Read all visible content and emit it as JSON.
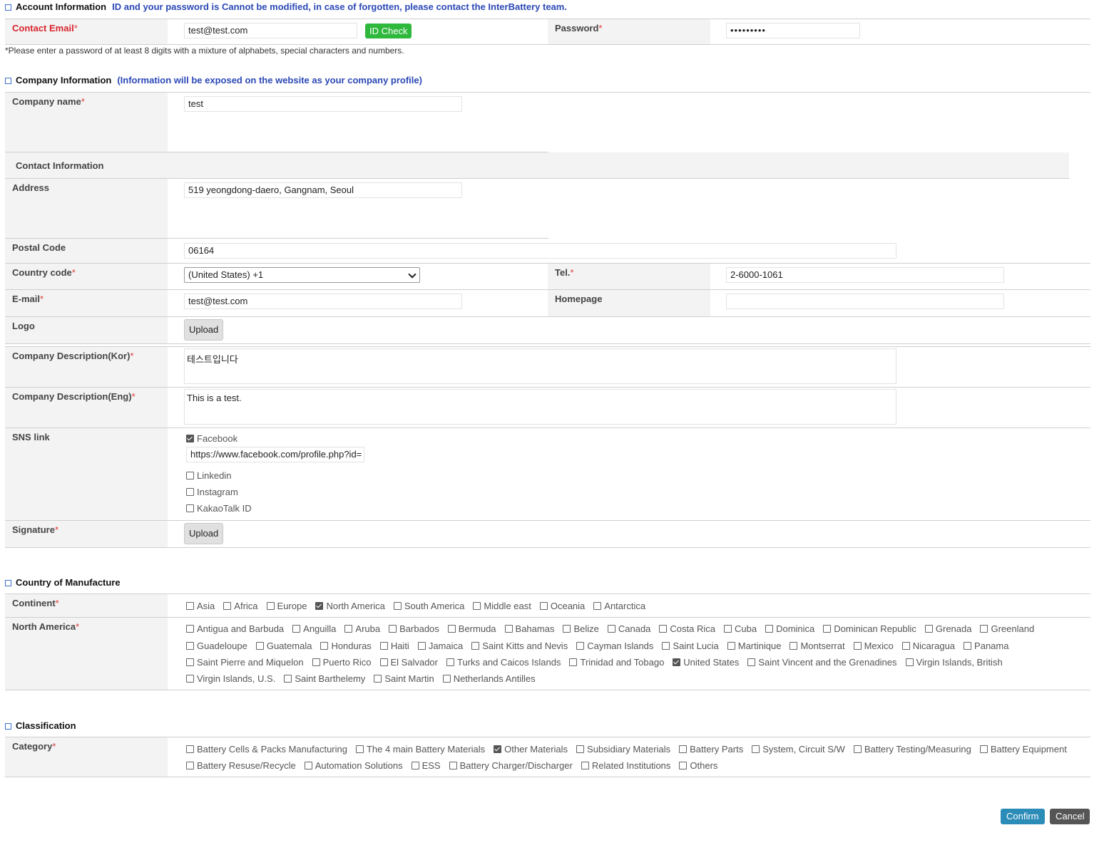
{
  "account": {
    "title": "Account Information",
    "note": "ID and your password is Cannot be modified, in case of forgotten, please contact the InterBattery team.",
    "contact_email_label": "Contact Email",
    "contact_email_value": "test@test.com",
    "id_check": "ID Check",
    "password_label": "Password",
    "password_value": "•••••••••",
    "password_hint": "*Please enter a password of at least 8 digits with a mixture of alphabets, special characters and numbers."
  },
  "company": {
    "title": "Company Information",
    "note": "(Information will be exposed on the website as your company profile)",
    "name_label": "Company name",
    "name_value": "test",
    "contact_info": "Contact Information",
    "address_label": "Address",
    "address_value": "519 yeongdong-daero, Gangnam, Seoul",
    "postal_label": "Postal Code",
    "postal_value": "06164",
    "country_code_label": "Country code",
    "country_code_value": "(United States) +1",
    "tel_label": "Tel.",
    "tel_value": "2-6000-1061",
    "email_label": "E-mail",
    "email_value": "test@test.com",
    "homepage_label": "Homepage",
    "homepage_value": "",
    "logo_label": "Logo",
    "upload": "Upload",
    "desc_kor_label": "Company Description(Kor)",
    "desc_kor_value": "테스트입니다",
    "desc_eng_label": "Company Description(Eng)",
    "desc_eng_value": "This is a test.",
    "sns_label": "SNS link",
    "sns": [
      {
        "label": "Facebook",
        "checked": true
      },
      {
        "label": "Linkedin",
        "checked": false
      },
      {
        "label": "Instagram",
        "checked": false
      },
      {
        "label": "KakaoTalk ID",
        "checked": false
      }
    ],
    "facebook_url": "https://www.facebook.com/profile.php?id=",
    "signature_label": "Signature"
  },
  "manufacture": {
    "title": "Country of Manufacture",
    "continent_label": "Continent",
    "continents": [
      {
        "label": "Asia",
        "checked": false
      },
      {
        "label": "Africa",
        "checked": false
      },
      {
        "label": "Europe",
        "checked": false
      },
      {
        "label": "North America",
        "checked": true
      },
      {
        "label": "South America",
        "checked": false
      },
      {
        "label": "Middle east",
        "checked": false
      },
      {
        "label": "Oceania",
        "checked": false
      },
      {
        "label": "Antarctica",
        "checked": false
      }
    ],
    "region_label": "North America",
    "country_rows": [
      [
        {
          "label": "Antigua and Barbuda",
          "checked": false
        },
        {
          "label": "Anguilla",
          "checked": false
        },
        {
          "label": "Aruba",
          "checked": false
        },
        {
          "label": "Barbados",
          "checked": false
        },
        {
          "label": "Bermuda",
          "checked": false
        },
        {
          "label": "Bahamas",
          "checked": false
        },
        {
          "label": "Belize",
          "checked": false
        },
        {
          "label": "Canada",
          "checked": false
        },
        {
          "label": "Costa Rica",
          "checked": false
        },
        {
          "label": "Cuba",
          "checked": false
        },
        {
          "label": "Dominica",
          "checked": false
        },
        {
          "label": "Dominican Republic",
          "checked": false
        },
        {
          "label": "Grenada",
          "checked": false
        },
        {
          "label": "Greenland",
          "checked": false
        }
      ],
      [
        {
          "label": "Guadeloupe",
          "checked": false
        },
        {
          "label": "Guatemala",
          "checked": false
        },
        {
          "label": "Honduras",
          "checked": false
        },
        {
          "label": "Haiti",
          "checked": false
        },
        {
          "label": "Jamaica",
          "checked": false
        },
        {
          "label": "Saint Kitts and Nevis",
          "checked": false
        },
        {
          "label": "Cayman Islands",
          "checked": false
        },
        {
          "label": "Saint Lucia",
          "checked": false
        },
        {
          "label": "Martinique",
          "checked": false
        },
        {
          "label": "Montserrat",
          "checked": false
        },
        {
          "label": "Mexico",
          "checked": false
        },
        {
          "label": "Nicaragua",
          "checked": false
        },
        {
          "label": "Panama",
          "checked": false
        }
      ],
      [
        {
          "label": "Saint Pierre and Miquelon",
          "checked": false
        },
        {
          "label": "Puerto Rico",
          "checked": false
        },
        {
          "label": "El Salvador",
          "checked": false
        },
        {
          "label": "Turks and Caicos Islands",
          "checked": false
        },
        {
          "label": "Trinidad and Tobago",
          "checked": false
        },
        {
          "label": "United States",
          "checked": true
        },
        {
          "label": "Saint Vincent and the Grenadines",
          "checked": false
        },
        {
          "label": "Virgin Islands, British",
          "checked": false
        }
      ],
      [
        {
          "label": "Virgin Islands, U.S.",
          "checked": false
        },
        {
          "label": "Saint Barthelemy",
          "checked": false
        },
        {
          "label": "Saint Martin",
          "checked": false
        },
        {
          "label": "Netherlands Antilles",
          "checked": false
        }
      ]
    ]
  },
  "classification": {
    "title": "Classification",
    "category_label": "Category",
    "rows": [
      [
        {
          "label": "Battery Cells & Packs Manufacturing",
          "checked": false
        },
        {
          "label": "The 4 main Battery Materials",
          "checked": false
        },
        {
          "label": "Other Materials",
          "checked": true
        },
        {
          "label": "Subsidiary Materials",
          "checked": false
        },
        {
          "label": "Battery Parts",
          "checked": false
        },
        {
          "label": "System, Circuit S/W",
          "checked": false
        },
        {
          "label": "Battery Testing/Measuring",
          "checked": false
        },
        {
          "label": "Battery Equipment",
          "checked": false
        }
      ],
      [
        {
          "label": "Battery Resuse/Recycle",
          "checked": false
        },
        {
          "label": "Automation Solutions",
          "checked": false
        },
        {
          "label": "ESS",
          "checked": false
        },
        {
          "label": "Battery Charger/Discharger",
          "checked": false
        },
        {
          "label": "Related Institutions",
          "checked": false
        },
        {
          "label": "Others",
          "checked": false
        }
      ]
    ]
  },
  "actions": {
    "confirm": "Confirm",
    "cancel": "Cancel"
  },
  "colors": {
    "accent": "#2eb83c",
    "confirm": "#2c8cb8",
    "cancel": "#555555",
    "required": "#e03a3a",
    "note": "#2b48b5"
  }
}
